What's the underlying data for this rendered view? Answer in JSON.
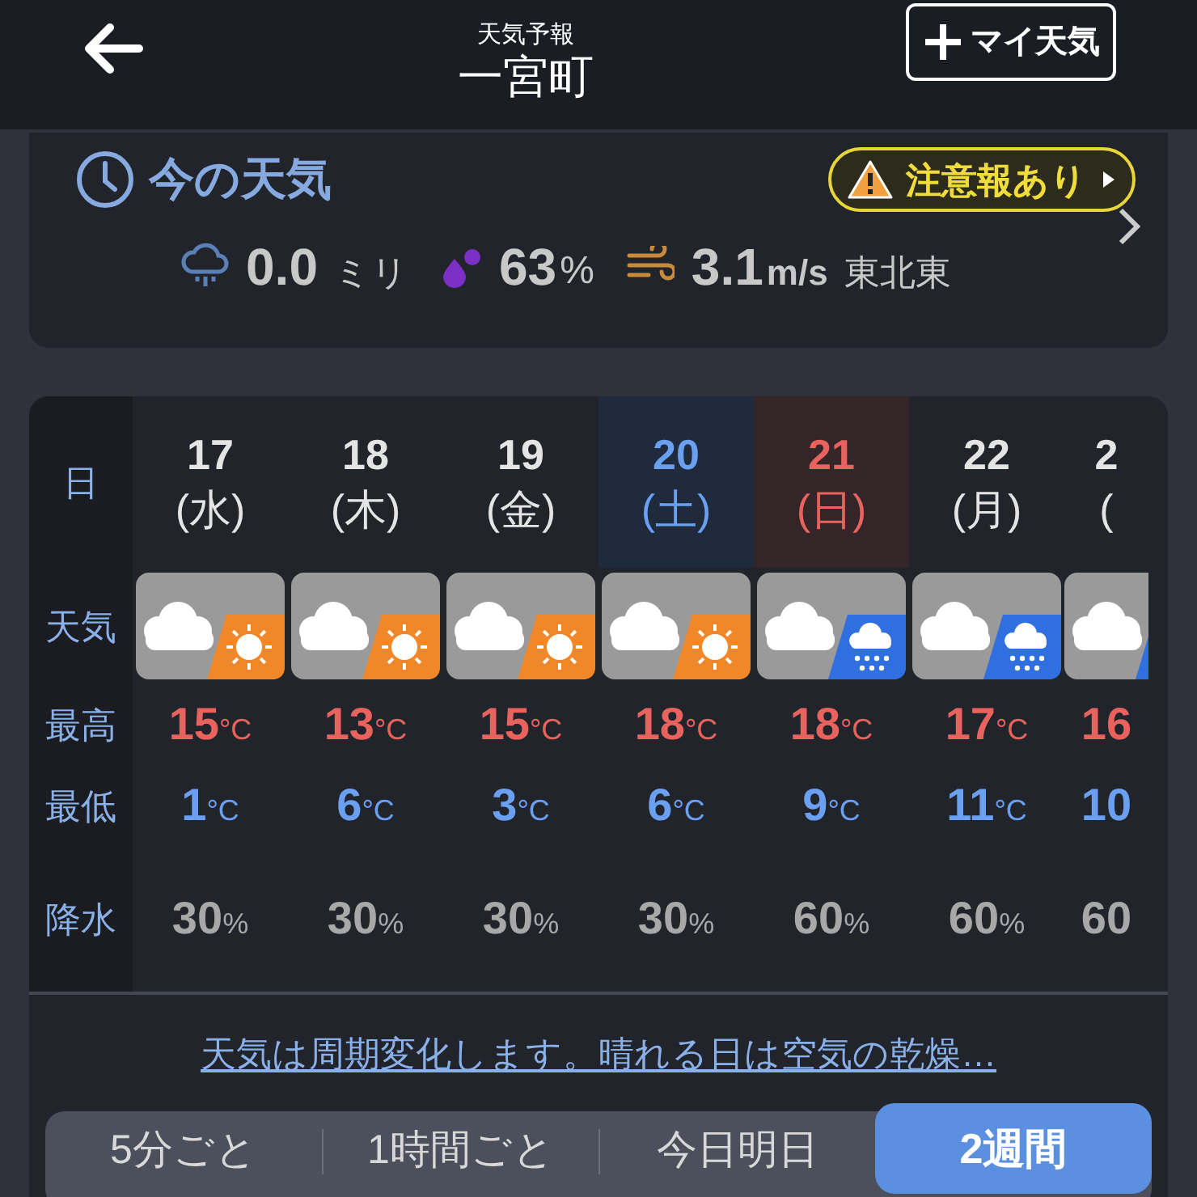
{
  "header": {
    "subtitle": "天気予報",
    "title": "一宮町",
    "my_weather_button": "マイ天気"
  },
  "current": {
    "title": "今の天気",
    "alert": "注意報あり",
    "rain": {
      "value": "0.0",
      "unit": "ミリ"
    },
    "humidity": {
      "value": "63",
      "unit": "%"
    },
    "wind": {
      "value": "3.1",
      "unit": "m/s",
      "direction": "東北東"
    }
  },
  "forecast": {
    "row_labels": {
      "day": "日",
      "weather": "天気",
      "high": "最高",
      "low": "最低",
      "precip": "降水"
    },
    "days": [
      {
        "day": "17",
        "weekday": "(水)",
        "saturday": false,
        "sunday": false,
        "kind": "sunny_spells",
        "high": "15",
        "high_unit": "°C",
        "low": "1",
        "low_unit": "°C",
        "precip": "30",
        "precip_unit": "%"
      },
      {
        "day": "18",
        "weekday": "(木)",
        "saturday": false,
        "sunday": false,
        "kind": "sunny_spells",
        "high": "13",
        "high_unit": "°C",
        "low": "6",
        "low_unit": "°C",
        "precip": "30",
        "precip_unit": "%"
      },
      {
        "day": "19",
        "weekday": "(金)",
        "saturday": false,
        "sunday": false,
        "kind": "sunny_spells",
        "high": "15",
        "high_unit": "°C",
        "low": "3",
        "low_unit": "°C",
        "precip": "30",
        "precip_unit": "%"
      },
      {
        "day": "20",
        "weekday": "(土)",
        "saturday": true,
        "sunday": false,
        "kind": "sunny_spells",
        "high": "18",
        "high_unit": "°C",
        "low": "6",
        "low_unit": "°C",
        "precip": "30",
        "precip_unit": "%"
      },
      {
        "day": "21",
        "weekday": "(日)",
        "saturday": false,
        "sunday": true,
        "kind": "showers",
        "high": "18",
        "high_unit": "°C",
        "low": "9",
        "low_unit": "°C",
        "precip": "60",
        "precip_unit": "%"
      },
      {
        "day": "22",
        "weekday": "(月)",
        "saturday": false,
        "sunday": false,
        "kind": "showers",
        "high": "17",
        "high_unit": "°C",
        "low": "11",
        "low_unit": "°C",
        "precip": "60",
        "precip_unit": "%"
      },
      {
        "day": "2",
        "weekday": "(",
        "saturday": false,
        "sunday": false,
        "kind": "showers",
        "high": "16",
        "low": "10",
        "precip": "60"
      }
    ]
  },
  "note_link": "天気は周期変化します。晴れる日は空気の乾燥…",
  "tabs": [
    {
      "label": "5分ごと",
      "selected": false
    },
    {
      "label": "1時間ごと",
      "selected": false
    },
    {
      "label": "今日明日",
      "selected": false
    },
    {
      "label": "2週間",
      "selected": true
    }
  ]
}
